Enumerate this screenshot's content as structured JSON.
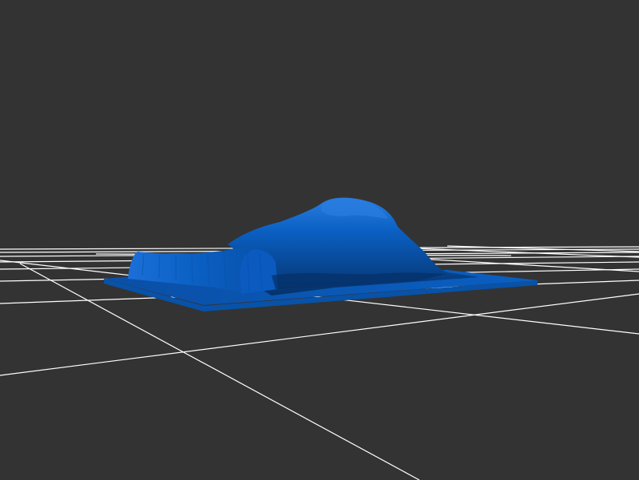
{
  "viewer": {
    "background_color": "#333333",
    "grid_color": "#ffffff",
    "model_color": "#0a5fc2",
    "model_shadow_color": "#06326a",
    "model_highlight_color": "#2a7de0",
    "base_plate_color": "#0b63cc",
    "grid_visible": true,
    "model_name": "terrain-mesh-on-base-plate"
  }
}
